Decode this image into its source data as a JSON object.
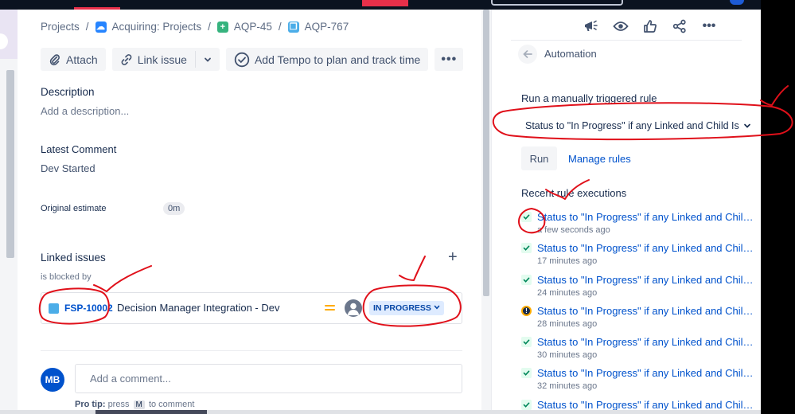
{
  "breadcrumb": {
    "projects": "Projects",
    "separator": "/",
    "project": "Acquiring: Projects",
    "parent": "AQP-45",
    "issue": "AQP-767"
  },
  "toolbar": {
    "attach": "Attach",
    "link_issue": "Link issue",
    "tempo": "Add Tempo to plan and track time",
    "more": "•••"
  },
  "description": {
    "label": "Description",
    "placeholder": "Add a description..."
  },
  "latest_comment": {
    "label": "Latest Comment",
    "value": "Dev Started"
  },
  "original_estimate": {
    "label": "Original estimate",
    "value": "0m"
  },
  "linked_issues": {
    "label": "Linked issues",
    "relation": "is blocked by",
    "add": "+",
    "items": [
      {
        "key": "FSP-10002",
        "summary": "Decision Manager Integration - Dev",
        "status": "IN PROGRESS"
      }
    ]
  },
  "comment": {
    "avatar": "MB",
    "placeholder": "Add a comment...",
    "protip_prefix": "Pro tip:",
    "protip_press": "press",
    "protip_key": "M",
    "protip_suffix": "to comment"
  },
  "right_panel": {
    "more": "•••",
    "automation_title": "Automation",
    "run_section_title": "Run a manually triggered rule",
    "selected_rule": "Status to \"In Progress\" if any Linked and Child Is",
    "run_button": "Run",
    "manage_rules": "Manage rules",
    "recent_title": "Recent rule executions",
    "executions": [
      {
        "name": "Status to \"In Progress\" if any Linked and Child I...",
        "time": "a few seconds ago",
        "status": "success"
      },
      {
        "name": "Status to \"In Progress\" if any Linked and Child I...",
        "time": "17 minutes ago",
        "status": "success"
      },
      {
        "name": "Status to \"In Progress\" if any Linked and Child I...",
        "time": "24 minutes ago",
        "status": "success"
      },
      {
        "name": "Status to \"In Progress\" if any Linked and Child I...",
        "time": "28 minutes ago",
        "status": "warning"
      },
      {
        "name": "Status to \"In Progress\" if any Linked and Child I...",
        "time": "30 minutes ago",
        "status": "success"
      },
      {
        "name": "Status to \"In Progress\" if any Linked and Child I...",
        "time": "32 minutes ago",
        "status": "success"
      },
      {
        "name": "Status to \"In Progress\" if any Linked and Child I...",
        "time": "",
        "status": "success"
      }
    ]
  },
  "colors": {
    "link_blue": "#0052cc",
    "annotation_red": "#e0101a",
    "status_bg": "#deebff",
    "priority_medium": "#ffab00"
  }
}
